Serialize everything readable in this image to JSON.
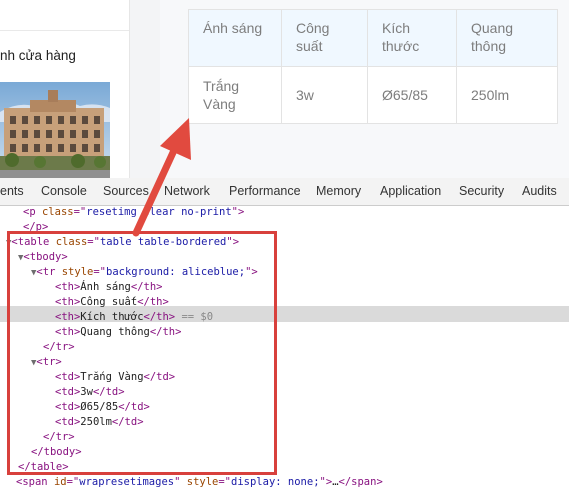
{
  "page": {
    "store_caption": "nh cửa hàng",
    "table": {
      "headers": [
        {
          "l1": "Ánh sáng",
          "l2": ""
        },
        {
          "l1": "Công",
          "l2": "suất"
        },
        {
          "l1": "Kích",
          "l2": "thước"
        },
        {
          "l1": "Quang",
          "l2": "thông"
        }
      ],
      "row": [
        {
          "l1": "Trắng",
          "l2": "Vàng"
        },
        {
          "l1": "3w",
          "l2": ""
        },
        {
          "l1": "Ø65/85",
          "l2": ""
        },
        {
          "l1": "250lm",
          "l2": ""
        }
      ]
    }
  },
  "devtools": {
    "tabs": [
      "ents",
      "Console",
      "Sources",
      "Network",
      "Performance",
      "Memory",
      "Application",
      "Security",
      "Audits"
    ],
    "dom": {
      "p_open": {
        "tag": "p",
        "attr": "class",
        "val": "resetimg clear no-print",
        "prefix": "<",
        "suffix": ">"
      },
      "p_close": "</p>",
      "table_open": {
        "tag": "table",
        "attr": "class",
        "val": "table table-bordered"
      },
      "tbody_open": "<tbody>",
      "tr1_open": {
        "tag": "tr",
        "attr": "style",
        "val": "background: aliceblue;"
      },
      "th_cells": [
        "Ánh sáng",
        "Công suất",
        "Kích thước",
        "Quang thông"
      ],
      "selected_marker": "== $0",
      "tr_close": "</tr>",
      "tr2_open": "<tr>",
      "td_cells": [
        "Trắng Vàng",
        "3w",
        "Ø65/85",
        "250lm"
      ],
      "tbody_close": "</tbody>",
      "table_close": "</table>",
      "span_line": {
        "tag": "span",
        "attr1": "id",
        "val1": "wrapresetimages",
        "attr2": "style",
        "val2": "display: none;",
        "ellipsis": "…",
        "close": "</span>"
      }
    },
    "accent_color": "#d8403c"
  }
}
